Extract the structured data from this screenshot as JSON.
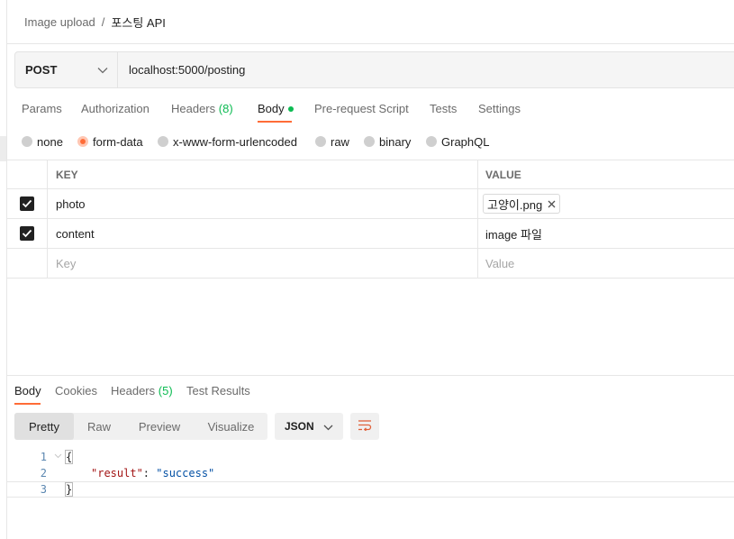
{
  "breadcrumb": {
    "parent": "Image upload",
    "separator": "/",
    "current": "포스팅 API"
  },
  "request": {
    "method": "POST",
    "url": "localhost:5000/posting"
  },
  "tabs": {
    "params": "Params",
    "authorization": "Authorization",
    "headers": "Headers",
    "headers_count": "(8)",
    "body": "Body",
    "prerequest": "Pre-request Script",
    "tests": "Tests",
    "settings": "Settings"
  },
  "body_modes": {
    "none": "none",
    "form_data": "form-data",
    "urlencoded": "x-www-form-urlencoded",
    "raw": "raw",
    "binary": "binary",
    "graphql": "GraphQL",
    "selected": "form-data"
  },
  "table": {
    "key_header": "KEY",
    "value_header": "VALUE",
    "rows": [
      {
        "key": "photo",
        "value": "고양이.png",
        "checked": true,
        "type": "file"
      },
      {
        "key": "content",
        "value": "image 파일",
        "checked": true,
        "type": "text"
      }
    ],
    "key_placeholder": "Key",
    "value_placeholder": "Value"
  },
  "response": {
    "tabs": {
      "body": "Body",
      "cookies": "Cookies",
      "headers": "Headers",
      "headers_count": "(5)",
      "test_results": "Test Results"
    },
    "views": {
      "pretty": "Pretty",
      "raw": "Raw",
      "preview": "Preview",
      "visualize": "Visualize"
    },
    "format": "JSON",
    "code": {
      "line1_num": "1",
      "line2_num": "2",
      "line3_num": "3",
      "open_brace": "{",
      "key": "\"result\"",
      "colon": ": ",
      "value": "\"success\"",
      "close_brace": "}"
    }
  },
  "colors": {
    "accent": "#ff6c37",
    "success": "#0cbb52",
    "json_key": "#a31515",
    "json_string": "#0451a5"
  },
  "icons": [
    "chevron-down-icon",
    "checkbox-checked-icon",
    "close-icon",
    "wrap-lines-icon"
  ]
}
